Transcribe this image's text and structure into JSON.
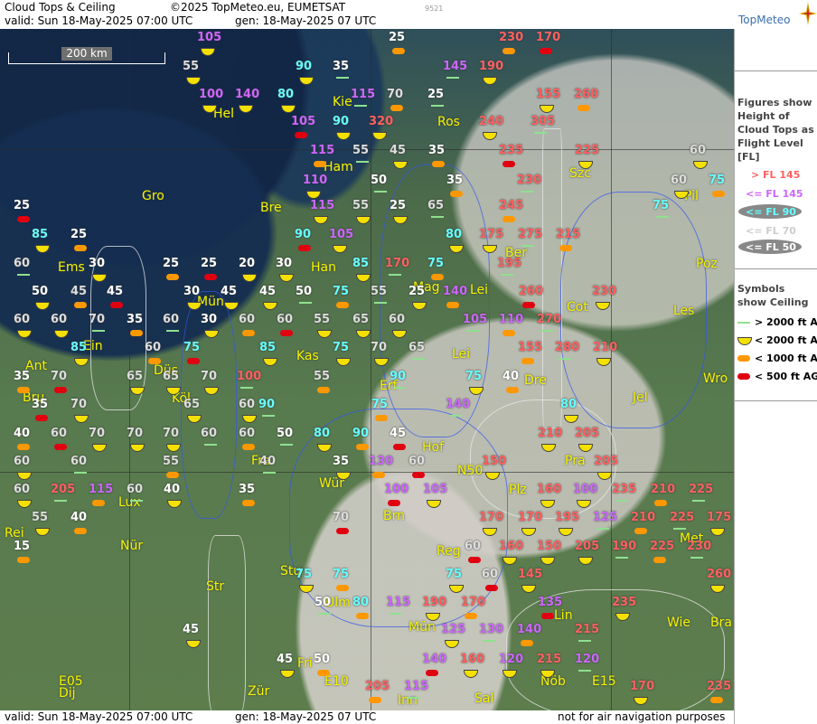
{
  "header": {
    "title": "Cloud Tops & Ceiling",
    "copyright": "©2025 TopMeteo.eu, EUMETSAT",
    "valid": "valid:  Sun  18-May-2025  07:00 UTC",
    "gen": "gen: 18-May-2025 07 UTC",
    "code": "9521",
    "logo": "TopMeteo"
  },
  "footer": {
    "valid": "valid:  Sun  18-May-2025  07:00 UTC",
    "gen": "gen: 18-May-2025 07 UTC",
    "note": "not for air navigation purposes"
  },
  "scale_label": "200 km",
  "legend": {
    "heading": "Figures show Height of Cloud Tops as Flight Level  [FL]",
    "levels": [
      {
        "label": "> FL 145",
        "color": "#ff6060"
      },
      {
        "label": "<= FL 145",
        "color": "#cc66ff"
      },
      {
        "label": "<= FL 90",
        "color": "#66ffff"
      },
      {
        "label": "<= FL 70",
        "color": "#cccccc"
      },
      {
        "label": "<= FL 50",
        "color": "#ffffff"
      }
    ],
    "symbols_heading": "Symbols show Ceiling",
    "symbols": [
      {
        "label": "> 2000 ft AGL",
        "kind": "line"
      },
      {
        "label": "< 2000 ft AGL",
        "kind": "yellow"
      },
      {
        "label": "< 1000 ft AGL",
        "kind": "orange"
      },
      {
        "label": "< 500 ft AGL",
        "kind": "red"
      }
    ]
  },
  "colors": {
    "high": "#ff6060",
    "mid": "#cc66ff",
    "lowmid": "#66ffff",
    "low": "#dddddd",
    "lowest": "#ffffff",
    "city": "#f4f400"
  },
  "cities": [
    "Hel",
    "Kie",
    "Ros",
    "Gro",
    "Ham",
    "Szc",
    "Pil",
    "Bre",
    "Ber",
    "Poz",
    "Ems",
    "Han",
    "Mag",
    "Lei",
    "Mün",
    "Cot",
    "Les",
    "Ein",
    "Ant",
    "Düs",
    "Kas",
    "Lei",
    "Dre",
    "Wro",
    "Bru",
    "Köl",
    "Erf",
    "Jel",
    "Hof",
    "Fra",
    "Pra",
    "N50",
    "Lux",
    "Wür",
    "Plz",
    "Rei",
    "Nür",
    "Brn",
    "Met",
    "Reg",
    "Stu",
    "Str",
    "Ulm",
    "Lin",
    "Mün",
    "Wie",
    "Bra",
    "Fri",
    "E10",
    "Nöb",
    "E15",
    "Zür",
    "Inn",
    "Dij",
    "E05",
    "Sal"
  ],
  "labels": [
    {
      "v": "105",
      "c": "mid"
    },
    {
      "v": "55",
      "c": "low"
    },
    {
      "v": "90",
      "c": "lowmid"
    },
    {
      "v": "35",
      "c": "lowest"
    },
    {
      "v": "25",
      "c": "lowest"
    },
    {
      "v": "145",
      "c": "mid"
    },
    {
      "v": "190",
      "c": "high"
    },
    {
      "v": "230",
      "c": "high"
    },
    {
      "v": "170",
      "c": "high"
    },
    {
      "v": "100",
      "c": "mid"
    },
    {
      "v": "140",
      "c": "mid"
    },
    {
      "v": "80",
      "c": "lowmid"
    },
    {
      "v": "115",
      "c": "mid"
    },
    {
      "v": "70",
      "c": "low"
    },
    {
      "v": "25",
      "c": "lowest"
    },
    {
      "v": "155",
      "c": "high"
    },
    {
      "v": "260",
      "c": "high"
    },
    {
      "v": "105",
      "c": "mid"
    },
    {
      "v": "90",
      "c": "lowmid"
    },
    {
      "v": "320",
      "c": "high"
    },
    {
      "v": "240",
      "c": "high"
    },
    {
      "v": "305",
      "c": "high"
    },
    {
      "v": "115",
      "c": "mid"
    },
    {
      "v": "55",
      "c": "low"
    },
    {
      "v": "45",
      "c": "low"
    },
    {
      "v": "35",
      "c": "lowest"
    },
    {
      "v": "235",
      "c": "high"
    },
    {
      "v": "225",
      "c": "high"
    },
    {
      "v": "60",
      "c": "low"
    },
    {
      "v": "110",
      "c": "mid"
    },
    {
      "v": "50",
      "c": "lowest"
    },
    {
      "v": "35",
      "c": "lowest"
    },
    {
      "v": "230",
      "c": "high"
    },
    {
      "v": "60",
      "c": "low"
    },
    {
      "v": "75",
      "c": "lowmid"
    },
    {
      "v": "25",
      "c": "lowest"
    },
    {
      "v": "115",
      "c": "mid"
    },
    {
      "v": "55",
      "c": "low"
    },
    {
      "v": "25",
      "c": "lowest"
    },
    {
      "v": "65",
      "c": "low"
    },
    {
      "v": "245",
      "c": "high"
    },
    {
      "v": "75",
      "c": "lowmid"
    },
    {
      "v": "85",
      "c": "lowmid"
    },
    {
      "v": "25",
      "c": "lowest"
    },
    {
      "v": "90",
      "c": "lowmid"
    },
    {
      "v": "105",
      "c": "mid"
    },
    {
      "v": "80",
      "c": "lowmid"
    },
    {
      "v": "175",
      "c": "high"
    },
    {
      "v": "275",
      "c": "high"
    },
    {
      "v": "215",
      "c": "high"
    },
    {
      "v": "60",
      "c": "low"
    },
    {
      "v": "30",
      "c": "lowest"
    },
    {
      "v": "25",
      "c": "lowest"
    },
    {
      "v": "25",
      "c": "lowest"
    },
    {
      "v": "20",
      "c": "lowest"
    },
    {
      "v": "30",
      "c": "lowest"
    },
    {
      "v": "85",
      "c": "lowmid"
    },
    {
      "v": "170",
      "c": "high"
    },
    {
      "v": "75",
      "c": "lowmid"
    },
    {
      "v": "195",
      "c": "high"
    },
    {
      "v": "50",
      "c": "lowest"
    },
    {
      "v": "45",
      "c": "low"
    },
    {
      "v": "45",
      "c": "lowest"
    },
    {
      "v": "30",
      "c": "lowest"
    },
    {
      "v": "45",
      "c": "lowest"
    },
    {
      "v": "45",
      "c": "lowest"
    },
    {
      "v": "50",
      "c": "lowest"
    },
    {
      "v": "75",
      "c": "lowmid"
    },
    {
      "v": "55",
      "c": "low"
    },
    {
      "v": "25",
      "c": "lowest"
    },
    {
      "v": "140",
      "c": "mid"
    },
    {
      "v": "260",
      "c": "high"
    },
    {
      "v": "230",
      "c": "high"
    },
    {
      "v": "60",
      "c": "low"
    },
    {
      "v": "60",
      "c": "low"
    },
    {
      "v": "70",
      "c": "low"
    },
    {
      "v": "35",
      "c": "lowest"
    },
    {
      "v": "60",
      "c": "low"
    },
    {
      "v": "30",
      "c": "lowest"
    },
    {
      "v": "60",
      "c": "low"
    },
    {
      "v": "60",
      "c": "low"
    },
    {
      "v": "55",
      "c": "low"
    },
    {
      "v": "65",
      "c": "low"
    },
    {
      "v": "60",
      "c": "low"
    },
    {
      "v": "105",
      "c": "mid"
    },
    {
      "v": "110",
      "c": "mid"
    },
    {
      "v": "270",
      "c": "high"
    },
    {
      "v": "85",
      "c": "lowmid"
    },
    {
      "v": "60",
      "c": "low"
    },
    {
      "v": "75",
      "c": "lowmid"
    },
    {
      "v": "85",
      "c": "lowmid"
    },
    {
      "v": "75",
      "c": "lowmid"
    },
    {
      "v": "70",
      "c": "low"
    },
    {
      "v": "65",
      "c": "low"
    },
    {
      "v": "155",
      "c": "high"
    },
    {
      "v": "280",
      "c": "high"
    },
    {
      "v": "210",
      "c": "high"
    },
    {
      "v": "35",
      "c": "lowest"
    },
    {
      "v": "70",
      "c": "low"
    },
    {
      "v": "65",
      "c": "low"
    },
    {
      "v": "65",
      "c": "low"
    },
    {
      "v": "70",
      "c": "low"
    },
    {
      "v": "100",
      "c": "high"
    },
    {
      "v": "55",
      "c": "low"
    },
    {
      "v": "90",
      "c": "lowmid"
    },
    {
      "v": "75",
      "c": "lowmid"
    },
    {
      "v": "40",
      "c": "lowest"
    },
    {
      "v": "35",
      "c": "lowest"
    },
    {
      "v": "70",
      "c": "low"
    },
    {
      "v": "65",
      "c": "low"
    },
    {
      "v": "60",
      "c": "low"
    },
    {
      "v": "90",
      "c": "lowmid"
    },
    {
      "v": "75",
      "c": "lowmid"
    },
    {
      "v": "140",
      "c": "mid"
    },
    {
      "v": "80",
      "c": "lowmid"
    },
    {
      "v": "40",
      "c": "lowest"
    },
    {
      "v": "60",
      "c": "low"
    },
    {
      "v": "70",
      "c": "low"
    },
    {
      "v": "70",
      "c": "low"
    },
    {
      "v": "70",
      "c": "low"
    },
    {
      "v": "60",
      "c": "low"
    },
    {
      "v": "60",
      "c": "low"
    },
    {
      "v": "50",
      "c": "lowest"
    },
    {
      "v": "80",
      "c": "lowmid"
    },
    {
      "v": "90",
      "c": "lowmid"
    },
    {
      "v": "45",
      "c": "lowest"
    },
    {
      "v": "210",
      "c": "high"
    },
    {
      "v": "205",
      "c": "high"
    },
    {
      "v": "60",
      "c": "low"
    },
    {
      "v": "60",
      "c": "low"
    },
    {
      "v": "55",
      "c": "low"
    },
    {
      "v": "40",
      "c": "low"
    },
    {
      "v": "35",
      "c": "lowest"
    },
    {
      "v": "130",
      "c": "mid"
    },
    {
      "v": "60",
      "c": "low"
    },
    {
      "v": "150",
      "c": "high"
    },
    {
      "v": "205",
      "c": "high"
    },
    {
      "v": "60",
      "c": "low"
    },
    {
      "v": "205",
      "c": "high"
    },
    {
      "v": "115",
      "c": "mid"
    },
    {
      "v": "60",
      "c": "low"
    },
    {
      "v": "40",
      "c": "lowest"
    },
    {
      "v": "35",
      "c": "lowest"
    },
    {
      "v": "100",
      "c": "mid"
    },
    {
      "v": "105",
      "c": "mid"
    },
    {
      "v": "160",
      "c": "high"
    },
    {
      "v": "100",
      "c": "mid"
    },
    {
      "v": "235",
      "c": "high"
    },
    {
      "v": "210",
      "c": "high"
    },
    {
      "v": "225",
      "c": "high"
    },
    {
      "v": "55",
      "c": "low"
    },
    {
      "v": "40",
      "c": "lowest"
    },
    {
      "v": "70",
      "c": "low"
    },
    {
      "v": "170",
      "c": "high"
    },
    {
      "v": "170",
      "c": "high"
    },
    {
      "v": "195",
      "c": "high"
    },
    {
      "v": "125",
      "c": "mid"
    },
    {
      "v": "210",
      "c": "high"
    },
    {
      "v": "225",
      "c": "high"
    },
    {
      "v": "175",
      "c": "high"
    },
    {
      "v": "15",
      "c": "lowest"
    },
    {
      "v": "60",
      "c": "low"
    },
    {
      "v": "160",
      "c": "high"
    },
    {
      "v": "150",
      "c": "high"
    },
    {
      "v": "205",
      "c": "high"
    },
    {
      "v": "190",
      "c": "high"
    },
    {
      "v": "225",
      "c": "high"
    },
    {
      "v": "230",
      "c": "high"
    },
    {
      "v": "75",
      "c": "lowmid"
    },
    {
      "v": "75",
      "c": "lowmid"
    },
    {
      "v": "60",
      "c": "low"
    },
    {
      "v": "75",
      "c": "lowmid"
    },
    {
      "v": "145",
      "c": "high"
    },
    {
      "v": "260",
      "c": "high"
    },
    {
      "v": "50",
      "c": "lowest"
    },
    {
      "v": "80",
      "c": "lowmid"
    },
    {
      "v": "115",
      "c": "mid"
    },
    {
      "v": "190",
      "c": "high"
    },
    {
      "v": "170",
      "c": "high"
    },
    {
      "v": "135",
      "c": "mid"
    },
    {
      "v": "235",
      "c": "high"
    },
    {
      "v": "45",
      "c": "lowest"
    },
    {
      "v": "125",
      "c": "mid"
    },
    {
      "v": "130",
      "c": "mid"
    },
    {
      "v": "140",
      "c": "mid"
    },
    {
      "v": "215",
      "c": "high"
    },
    {
      "v": "45",
      "c": "lowest"
    },
    {
      "v": "50",
      "c": "lowest"
    },
    {
      "v": "140",
      "c": "mid"
    },
    {
      "v": "160",
      "c": "high"
    },
    {
      "v": "120",
      "c": "mid"
    },
    {
      "v": "215",
      "c": "high"
    },
    {
      "v": "120",
      "c": "mid"
    },
    {
      "v": "205",
      "c": "high"
    },
    {
      "v": "115",
      "c": "mid"
    },
    {
      "v": "170",
      "c": "high"
    },
    {
      "v": "235",
      "c": "high"
    }
  ]
}
